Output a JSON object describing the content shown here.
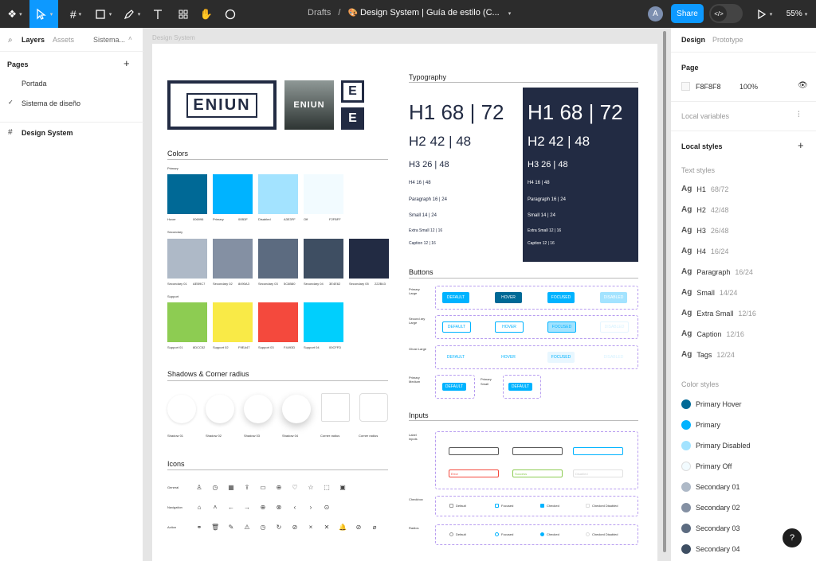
{
  "toolbar": {
    "breadcrumb_prefix": "Drafts",
    "breadcrumb_sep": "/",
    "file_name": "Design System | Guía de estilo (C...",
    "avatar": "A",
    "share": "Share",
    "zoom": "55%"
  },
  "left": {
    "tab_layers": "Layers",
    "tab_assets": "Assets",
    "page_dropdown": "Sistema...",
    "pages_title": "Pages",
    "pages": [
      "Portada",
      "Sistema de diseño"
    ],
    "frame": "Design System"
  },
  "canvas": {
    "frame_label": "Design System"
  },
  "logos": {
    "word": "ENIUN",
    "letter": "E"
  },
  "colors": {
    "title": "Colors",
    "primary_label": "Primary",
    "primary": [
      {
        "name": "Hover",
        "hex": "006996",
        "color": "#006996"
      },
      {
        "name": "Primary",
        "hex": "00B3F",
        "color": "#00b3ff"
      },
      {
        "name": "Disabled",
        "hex": "A3E3FF",
        "color": "#a3e3ff"
      },
      {
        "name": "Off",
        "hex": "F2FBFF",
        "color": "#f2fbff"
      }
    ],
    "secondary_label": "Secondary",
    "secondary": [
      {
        "name": "Secondary 01",
        "hex": "AEB9C7",
        "color": "#aeb9c7"
      },
      {
        "name": "Secondary 02",
        "hex": "8490A3",
        "color": "#8490a3"
      },
      {
        "name": "Secondary 03",
        "hex": "5C6B80",
        "color": "#5c6b80"
      },
      {
        "name": "Secondary 04",
        "hex": "3E4E62",
        "color": "#3e4e62"
      },
      {
        "name": "Secondary 05",
        "hex": "222B43",
        "color": "#222b43"
      }
    ],
    "support_label": "Support",
    "support": [
      {
        "name": "Support 01",
        "hex": "8DCC52",
        "color": "#8dcc52"
      },
      {
        "name": "Support 02",
        "hex": "F9EA47",
        "color": "#f9ea47"
      },
      {
        "name": "Support 03",
        "hex": "F4493D",
        "color": "#f4493d"
      },
      {
        "name": "Support 04",
        "hex": "00CFFD",
        "color": "#00cffd"
      }
    ]
  },
  "shadows": {
    "title": "Shadows & Corner radius",
    "items": [
      "Shadow 01",
      "Shadow 02",
      "Shadow 03",
      "Shadow 04",
      "Corner radius",
      "Corner radius"
    ]
  },
  "icons": {
    "title": "Icons",
    "rows": [
      {
        "label": "General",
        "glyphs": [
          "♙",
          "◷",
          "▦",
          "⇪",
          "▭",
          "⊕",
          "♡",
          "☆",
          "⬚",
          "▣"
        ]
      },
      {
        "label": "Navigation",
        "glyphs": [
          "⌂",
          "˄",
          "←",
          "→",
          "⊕",
          "⊗",
          "‹",
          "›",
          "⊙"
        ]
      },
      {
        "label": "Action",
        "glyphs": [
          "⚭",
          "🗑",
          "✎",
          "⚠",
          "◷",
          "↻",
          "⊘",
          "×",
          "✕",
          "🔔",
          "⊘",
          "⌀"
        ]
      }
    ]
  },
  "typography": {
    "title": "Typography",
    "samples": [
      "H1 68 | 72",
      "H2 42 | 48",
      "H3 26 | 48",
      "H4 16 | 48",
      "Paragraph 16 | 24",
      "Small 14 | 24",
      "Extra Small 12 | 16",
      "Caption 12 | 16"
    ]
  },
  "buttons": {
    "title": "Buttons",
    "rows": [
      {
        "label": "Primary Large"
      },
      {
        "label": "Secund ary Large"
      },
      {
        "label": "Ghost Large"
      },
      {
        "label": "Primary Medium"
      }
    ],
    "states": [
      "DEFAULT",
      "HOVER",
      "FOCUSED",
      "DISABLED"
    ],
    "primary_small": "Primary Small",
    "default": "DEFAULT"
  },
  "inputs": {
    "title": "Inputs",
    "label_inputs": "Label inputs",
    "error": "Error",
    "success": "Success",
    "disabled": "Disabled",
    "checkbox": "Checkbox",
    "radios": "Radios",
    "checkbox_states": [
      "Default",
      "Focused",
      "Checked",
      "Checked Disabled"
    ],
    "radio_states": [
      "Default",
      "Focused",
      "Checked",
      "Checked Disabled"
    ]
  },
  "right": {
    "tab_design": "Design",
    "tab_prototype": "Prototype",
    "page_title": "Page",
    "page_color": "F8F8F8",
    "page_opacity": "100%",
    "local_variables": "Local variables",
    "local_styles": "Local styles",
    "text_styles_title": "Text styles",
    "text_styles": [
      {
        "name": "H1",
        "size": "68/72"
      },
      {
        "name": "H2",
        "size": "42/48"
      },
      {
        "name": "H3",
        "size": "26/48"
      },
      {
        "name": "H4",
        "size": "16/24"
      },
      {
        "name": "Paragraph",
        "size": "16/24"
      },
      {
        "name": "Small",
        "size": "14/24"
      },
      {
        "name": "Extra Small",
        "size": "12/16"
      },
      {
        "name": "Caption",
        "size": "12/16"
      },
      {
        "name": "Tags",
        "size": "12/24"
      }
    ],
    "color_styles_title": "Color styles",
    "color_styles": [
      {
        "name": "Primary Hover",
        "color": "#006996"
      },
      {
        "name": "Primary",
        "color": "#00b3ff"
      },
      {
        "name": "Primary Disabled",
        "color": "#a3e3ff"
      },
      {
        "name": "Primary Off",
        "color": "#f2fbff"
      },
      {
        "name": "Secondary 01",
        "color": "#aeb9c7"
      },
      {
        "name": "Secondary 02",
        "color": "#8490a3"
      },
      {
        "name": "Secondary 03",
        "color": "#5c6b80"
      },
      {
        "name": "Secondary 04",
        "color": "#3e4e62"
      }
    ],
    "help": "?"
  }
}
